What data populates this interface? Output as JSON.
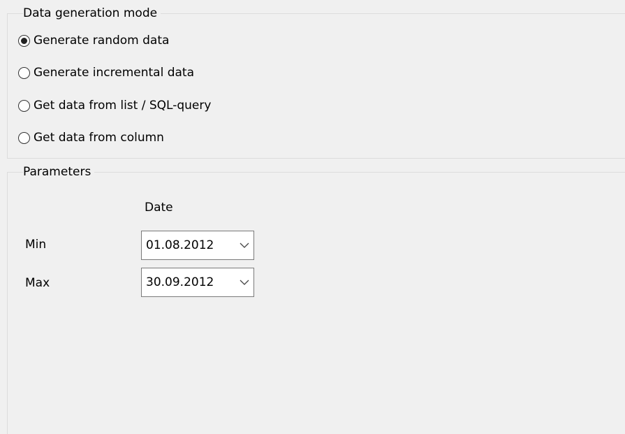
{
  "mode_group": {
    "title": "Data generation mode",
    "options": [
      {
        "label": "Generate random data",
        "selected": true
      },
      {
        "label": "Generate incremental data",
        "selected": false
      },
      {
        "label": "Get data from list / SQL-query",
        "selected": false
      },
      {
        "label": "Get data from column",
        "selected": false
      }
    ]
  },
  "params_group": {
    "title": "Parameters",
    "column_header": "Date",
    "min": {
      "label": "Min",
      "value": "01.08.2012"
    },
    "max": {
      "label": "Max",
      "value": "30.09.2012"
    }
  },
  "icons": {
    "dropdown": "chevron-down-icon"
  },
  "colors": {
    "panel_background": "#f0f0f0",
    "field_background": "#ffffff",
    "field_border": "#7a7a7a"
  }
}
